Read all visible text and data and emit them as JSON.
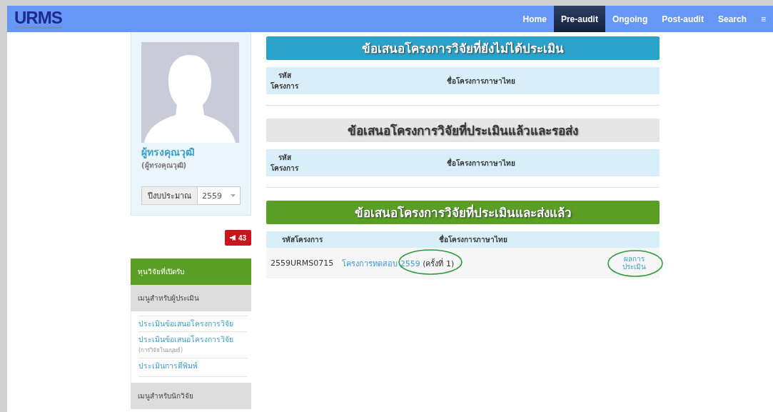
{
  "nav": {
    "logo": "URMS",
    "items": [
      {
        "label": "Home",
        "selected": false
      },
      {
        "label": "Pre-audit",
        "selected": true
      },
      {
        "label": "Ongoing",
        "selected": false
      },
      {
        "label": "Post-audit",
        "selected": false
      },
      {
        "label": "Search",
        "selected": false
      }
    ],
    "menu_icon": "≡"
  },
  "profile": {
    "name": "ผู้ทรงคุณวุฒิ",
    "subtitle": "(ผู้ทรงคุณวุฒิ)",
    "budget_label": "ปีงบประมาณ",
    "budget_value": "2559"
  },
  "notification_count": "43",
  "sidebar": {
    "header": "ทุนวิจัยที่เปิดรับ",
    "sections": [
      {
        "title": "เมนูสำหรับผู้ประเมิน",
        "links": [
          {
            "label": "ประเมินข้อเสนอโครงการวิจัย"
          },
          {
            "label": "ประเมินข้อเสนอโครงการวิจัย",
            "note": "(การวิจัยในมนุษย์)"
          },
          {
            "label": "ประเมินการตีพิมพ์"
          }
        ]
      },
      {
        "title": "เมนูสำหรับนักวิจัย"
      }
    ]
  },
  "sections": [
    {
      "title": "ข้อเสนอโครงการวิจัยที่ยังไม่ได้ประเมิน",
      "kind": "info",
      "columns": [
        "รหัส โครงการ",
        "ชื่อโครงการภาษาไทย"
      ]
    },
    {
      "title": "ข้อเสนอโครงการวิจัยที่ประเมินแล้วและรอส่ง",
      "kind": "muted",
      "columns": [
        "รหัส โครงการ",
        "ชื่อโครงการภาษาไทย"
      ]
    },
    {
      "title": "ข้อเสนอโครงการวิจัยที่ประเมินและส่งแล้ว",
      "kind": "success",
      "columns": [
        "รหัสโครงการ",
        "ชื่อโครงการภาษาไทย"
      ],
      "rows": [
        {
          "code": "2559URMS0715",
          "title": "โครงการทดสอบ 2559",
          "round": "(ครั้งที่ 1)",
          "action": "ผลการ ประเมิน",
          "title_circled": true,
          "action_circled": true
        }
      ]
    }
  ]
}
